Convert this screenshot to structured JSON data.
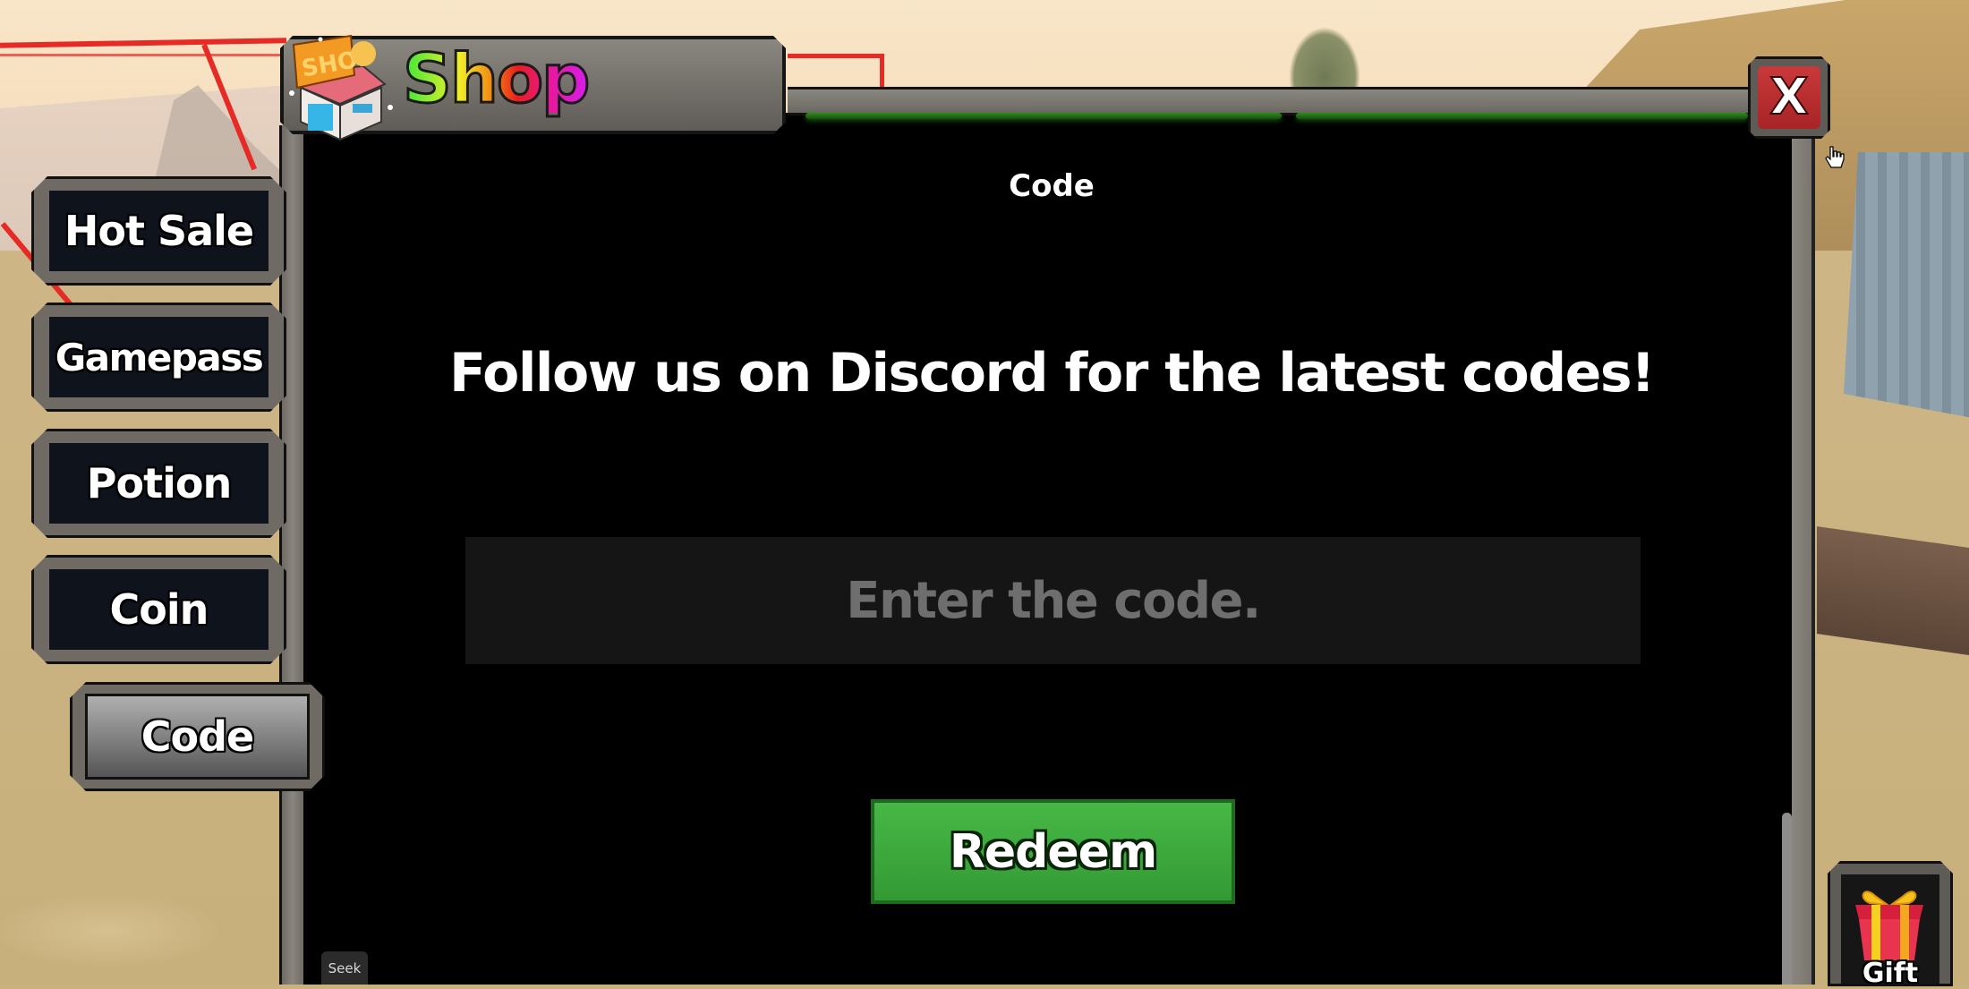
{
  "shop": {
    "title": "Shop",
    "icon": "shop-storefront-icon",
    "close_label": "X",
    "colors": {
      "close": "#b82d2f",
      "redeem": "#3fae3f",
      "glow": "#2f8a1f",
      "panel": "#000000",
      "frame": "#6f6b64"
    }
  },
  "sidebar": {
    "items": [
      {
        "label": "Hot Sale",
        "active": false
      },
      {
        "label": "Gamepass",
        "active": false
      },
      {
        "label": "Potion",
        "active": false
      },
      {
        "label": "Coin",
        "active": false
      },
      {
        "label": "Code",
        "active": true
      }
    ]
  },
  "content": {
    "section_title": "Code",
    "headline": "Follow us on Discord for the latest codes!",
    "code_input": {
      "value": "",
      "placeholder": "Enter the code."
    },
    "redeem_label": "Redeem"
  },
  "overlay": {
    "seek_tooltip": "Seek",
    "gift_label": "Gift",
    "gift_icon": "gift-box-icon"
  }
}
